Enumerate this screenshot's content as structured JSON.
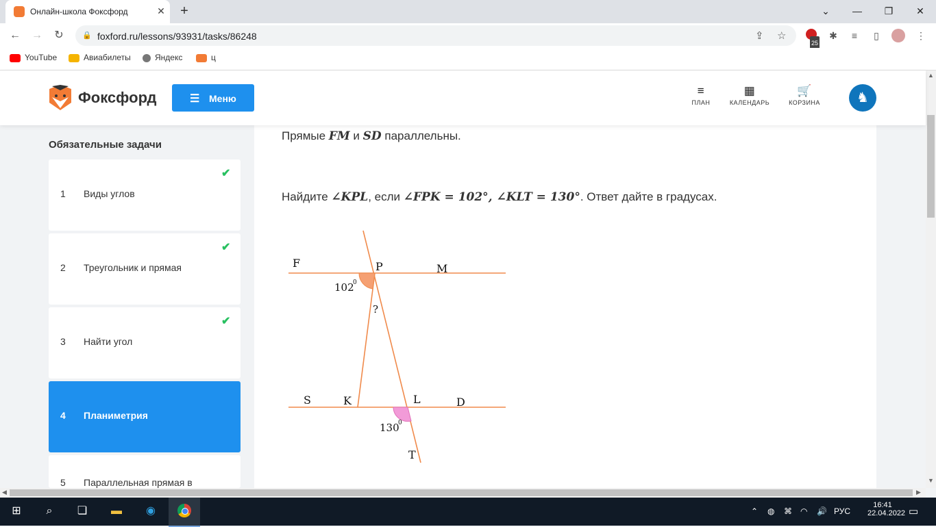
{
  "browser": {
    "tab_title": "Онлайн-школа Фоксфорд",
    "tab_close": "✕",
    "new_tab": "+",
    "window_controls": {
      "minimize": "—",
      "maximize": "❐",
      "close": "✕",
      "tablist": "⌄"
    },
    "url": "foxford.ru/lessons/93931/tasks/86248",
    "extension_badge": "25",
    "bookmarks": [
      "YouTube",
      "Авиабилеты",
      "Яндекс",
      "ц"
    ]
  },
  "header": {
    "logo_text": "Фоксфорд",
    "menu_label": "Меню",
    "nav": [
      {
        "label": "ПЛАН",
        "icon": "≡"
      },
      {
        "label": "КАЛЕНДАРЬ",
        "icon": "▦"
      },
      {
        "label": "КОРЗИНА",
        "icon": "🛒"
      }
    ]
  },
  "sidebar": {
    "title": "Обязательные задачи",
    "tasks": [
      {
        "num": "1",
        "name": "Виды углов",
        "done": true
      },
      {
        "num": "2",
        "name": "Треугольник и прямая",
        "done": true
      },
      {
        "num": "3",
        "name": "Найти угол",
        "done": true
      },
      {
        "num": "4",
        "name": "Планиметрия",
        "done": false,
        "active": true
      },
      {
        "num": "5",
        "name": "Параллельная прямая в",
        "done": false
      }
    ]
  },
  "problem": {
    "line1": {
      "prefix": "Прямые ",
      "a": "FM",
      "mid": " и ",
      "b": "SD",
      "suffix": " параллельны."
    },
    "line2": {
      "prefix": "Найдите ",
      "angle1": "∠KPL",
      "mid1": ", если ",
      "angle2": "∠FPK = 102°, ∠KLT = 130°",
      "suffix": ". Ответ дайте в градусах."
    }
  },
  "figure": {
    "labels": {
      "F": "F",
      "P": "P",
      "M": "M",
      "S": "S",
      "K": "K",
      "L": "L",
      "D": "D",
      "T": "T",
      "q": "?",
      "a1": "102",
      "a1_sup": "0",
      "a2": "130",
      "a2_sup": "0"
    },
    "colors": {
      "line": "#f08a4b",
      "arc1": "#f5a073",
      "arc2": "#f29bd8",
      "text": "#111111"
    }
  },
  "taskbar": {
    "lang": "РУС",
    "time": "16:41",
    "date": "22.04.2022"
  }
}
